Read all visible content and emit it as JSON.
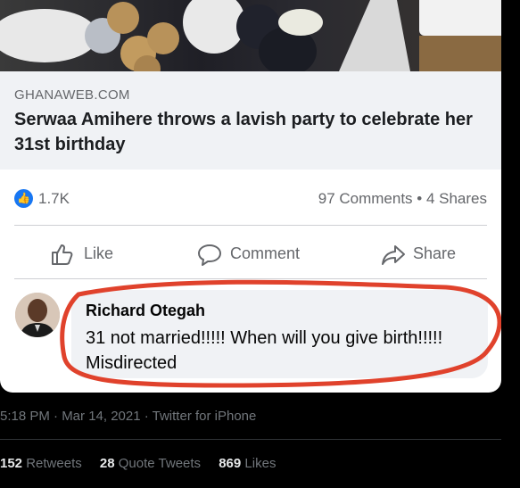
{
  "post": {
    "domain": "GHANAWEB.COM",
    "title": "Serwaa Amihere throws a lavish party to celebrate her 31st birthday",
    "reactions_count": "1.7K",
    "comments_shares": "97 Comments • 4 Shares",
    "like_label": "Like",
    "comment_label": "Comment",
    "share_label": "Share"
  },
  "comment": {
    "author": "Richard Otegah",
    "text": "31 not married!!!!! When will you give birth!!!!! Misdirected"
  },
  "tweet": {
    "meta": "5:18 PM · Mar 14, 2021 · Twitter for iPhone",
    "retweets_count": "152",
    "retweets_label": "Retweets",
    "quotes_count": "28",
    "quotes_label": "Quote Tweets",
    "likes_count": "869",
    "likes_label": "Likes"
  },
  "colors": {
    "facebook_blue": "#1877f2",
    "annotation_red": "#e0422c",
    "tweet_background": "#000000"
  },
  "icons": [
    "like-thumb-icon",
    "comment-bubble-icon",
    "share-arrow-icon",
    "reaction-like-icon"
  ]
}
